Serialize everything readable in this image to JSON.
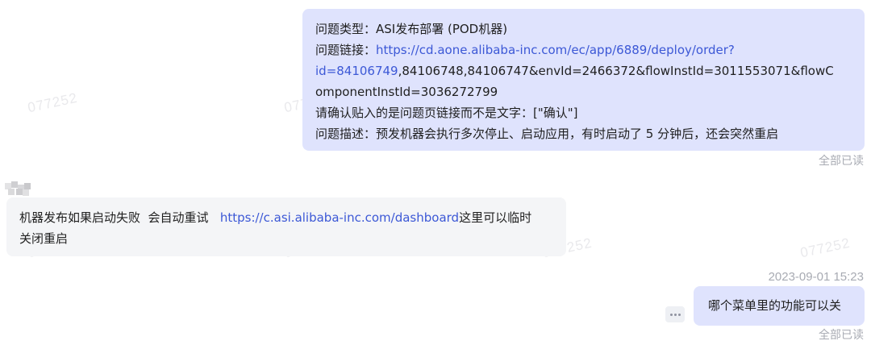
{
  "watermark_text": "077252",
  "messages": [
    {
      "direction": "outgoing",
      "lines": {
        "type": "问题类型：ASI发布部署 (POD机器)",
        "link_label": "问题链接：",
        "link_part1": "https://cd.aone.alibaba-inc.com/ec/app/6889/deploy/order?",
        "link_part2": "id=84106749",
        "link_rest": ",84106748,84106747&envId=2466372&flowInstId=3011553071&flowC",
        "link_rest2": "omponentInstId=3036272799",
        "confirm": "请确认贴入的是问题页链接而不是文字：[\"确认\"]",
        "description": "问题描述：预发机器会执行多次停止、启动应用，有时启动了 5 分钟后，还会突然重启"
      },
      "read_status": "全部已读"
    },
    {
      "direction": "incoming",
      "text_before": "机器发布如果启动失败  会自动重试   ",
      "link": "https://c.asi.alibaba-inc.com/dashboard",
      "text_after": "这里可以临时",
      "text_line2": "关闭重启"
    },
    {
      "direction": "outgoing",
      "timestamp": "2023-09-01 15:23",
      "text": "哪个菜单里的功能可以关",
      "read_status": "全部已读"
    }
  ],
  "icons": {
    "more": "more-dots-icon",
    "avatar": "avatar-blurred"
  }
}
